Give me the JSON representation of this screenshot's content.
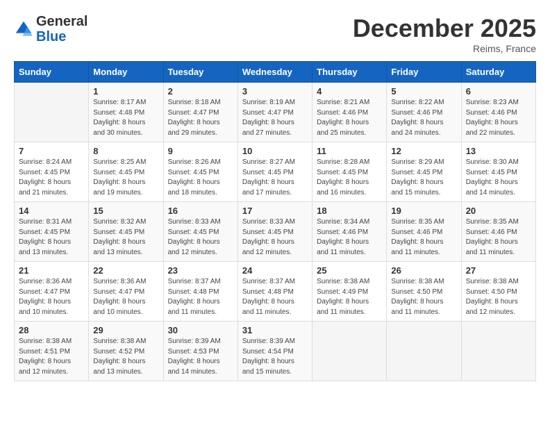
{
  "header": {
    "logo": {
      "general": "General",
      "blue": "Blue"
    },
    "title": "December 2025",
    "location": "Reims, France"
  },
  "columns": [
    "Sunday",
    "Monday",
    "Tuesday",
    "Wednesday",
    "Thursday",
    "Friday",
    "Saturday"
  ],
  "weeks": [
    [
      {
        "day": "",
        "info": ""
      },
      {
        "day": "1",
        "info": "Sunrise: 8:17 AM\nSunset: 4:48 PM\nDaylight: 8 hours\nand 30 minutes."
      },
      {
        "day": "2",
        "info": "Sunrise: 8:18 AM\nSunset: 4:47 PM\nDaylight: 8 hours\nand 29 minutes."
      },
      {
        "day": "3",
        "info": "Sunrise: 8:19 AM\nSunset: 4:47 PM\nDaylight: 8 hours\nand 27 minutes."
      },
      {
        "day": "4",
        "info": "Sunrise: 8:21 AM\nSunset: 4:46 PM\nDaylight: 8 hours\nand 25 minutes."
      },
      {
        "day": "5",
        "info": "Sunrise: 8:22 AM\nSunset: 4:46 PM\nDaylight: 8 hours\nand 24 minutes."
      },
      {
        "day": "6",
        "info": "Sunrise: 8:23 AM\nSunset: 4:46 PM\nDaylight: 8 hours\nand 22 minutes."
      }
    ],
    [
      {
        "day": "7",
        "info": "Sunrise: 8:24 AM\nSunset: 4:45 PM\nDaylight: 8 hours\nand 21 minutes."
      },
      {
        "day": "8",
        "info": "Sunrise: 8:25 AM\nSunset: 4:45 PM\nDaylight: 8 hours\nand 19 minutes."
      },
      {
        "day": "9",
        "info": "Sunrise: 8:26 AM\nSunset: 4:45 PM\nDaylight: 8 hours\nand 18 minutes."
      },
      {
        "day": "10",
        "info": "Sunrise: 8:27 AM\nSunset: 4:45 PM\nDaylight: 8 hours\nand 17 minutes."
      },
      {
        "day": "11",
        "info": "Sunrise: 8:28 AM\nSunset: 4:45 PM\nDaylight: 8 hours\nand 16 minutes."
      },
      {
        "day": "12",
        "info": "Sunrise: 8:29 AM\nSunset: 4:45 PM\nDaylight: 8 hours\nand 15 minutes."
      },
      {
        "day": "13",
        "info": "Sunrise: 8:30 AM\nSunset: 4:45 PM\nDaylight: 8 hours\nand 14 minutes."
      }
    ],
    [
      {
        "day": "14",
        "info": "Sunrise: 8:31 AM\nSunset: 4:45 PM\nDaylight: 8 hours\nand 13 minutes."
      },
      {
        "day": "15",
        "info": "Sunrise: 8:32 AM\nSunset: 4:45 PM\nDaylight: 8 hours\nand 13 minutes."
      },
      {
        "day": "16",
        "info": "Sunrise: 8:33 AM\nSunset: 4:45 PM\nDaylight: 8 hours\nand 12 minutes."
      },
      {
        "day": "17",
        "info": "Sunrise: 8:33 AM\nSunset: 4:45 PM\nDaylight: 8 hours\nand 12 minutes."
      },
      {
        "day": "18",
        "info": "Sunrise: 8:34 AM\nSunset: 4:46 PM\nDaylight: 8 hours\nand 11 minutes."
      },
      {
        "day": "19",
        "info": "Sunrise: 8:35 AM\nSunset: 4:46 PM\nDaylight: 8 hours\nand 11 minutes."
      },
      {
        "day": "20",
        "info": "Sunrise: 8:35 AM\nSunset: 4:46 PM\nDaylight: 8 hours\nand 11 minutes."
      }
    ],
    [
      {
        "day": "21",
        "info": "Sunrise: 8:36 AM\nSunset: 4:47 PM\nDaylight: 8 hours\nand 10 minutes."
      },
      {
        "day": "22",
        "info": "Sunrise: 8:36 AM\nSunset: 4:47 PM\nDaylight: 8 hours\nand 10 minutes."
      },
      {
        "day": "23",
        "info": "Sunrise: 8:37 AM\nSunset: 4:48 PM\nDaylight: 8 hours\nand 11 minutes."
      },
      {
        "day": "24",
        "info": "Sunrise: 8:37 AM\nSunset: 4:48 PM\nDaylight: 8 hours\nand 11 minutes."
      },
      {
        "day": "25",
        "info": "Sunrise: 8:38 AM\nSunset: 4:49 PM\nDaylight: 8 hours\nand 11 minutes."
      },
      {
        "day": "26",
        "info": "Sunrise: 8:38 AM\nSunset: 4:50 PM\nDaylight: 8 hours\nand 11 minutes."
      },
      {
        "day": "27",
        "info": "Sunrise: 8:38 AM\nSunset: 4:50 PM\nDaylight: 8 hours\nand 12 minutes."
      }
    ],
    [
      {
        "day": "28",
        "info": "Sunrise: 8:38 AM\nSunset: 4:51 PM\nDaylight: 8 hours\nand 12 minutes."
      },
      {
        "day": "29",
        "info": "Sunrise: 8:38 AM\nSunset: 4:52 PM\nDaylight: 8 hours\nand 13 minutes."
      },
      {
        "day": "30",
        "info": "Sunrise: 8:39 AM\nSunset: 4:53 PM\nDaylight: 8 hours\nand 14 minutes."
      },
      {
        "day": "31",
        "info": "Sunrise: 8:39 AM\nSunset: 4:54 PM\nDaylight: 8 hours\nand 15 minutes."
      },
      {
        "day": "",
        "info": ""
      },
      {
        "day": "",
        "info": ""
      },
      {
        "day": "",
        "info": ""
      }
    ]
  ]
}
